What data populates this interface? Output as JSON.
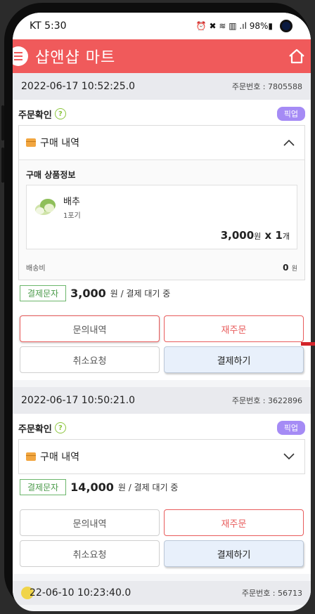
{
  "status_bar": {
    "carrier_time": "KT 5:30",
    "icons_text": "⏰ ✖ ≋ ▥ .ıl 98%▮"
  },
  "app": {
    "title": "샵앤샵 마트"
  },
  "orders": [
    {
      "datetime": "2022-06-17 10:52:25.0",
      "order_no": "주문번호 : 7805588",
      "confirm_label": "주문확인",
      "pickup_label": "픽업",
      "purchase_label": "구매 내역",
      "product_section": "구매 상품정보",
      "product_name": "배추",
      "product_unit": "1포기",
      "price_value": "3,000",
      "price_unit": "원",
      "qty_text": "x 1",
      "qty_unit": "개",
      "shipping_label": "배송비",
      "shipping_value": "0",
      "shipping_unit": "원",
      "pay_tag": "결제문자",
      "pay_amount": "3,000",
      "pay_status": "원 / 결제 대기 중",
      "btn_inquiry": "문의내역",
      "btn_reorder": "재주문",
      "btn_cancel": "취소요청",
      "btn_pay": "결제하기"
    },
    {
      "datetime": "2022-06-17 10:50:21.0",
      "order_no": "주문번호 : 3622896",
      "confirm_label": "주문확인",
      "pickup_label": "픽업",
      "purchase_label": "구매 내역",
      "pay_tag": "결제문자",
      "pay_amount": "14,000",
      "pay_status": "원 / 결제 대기 중",
      "btn_inquiry": "문의내역",
      "btn_reorder": "재주문",
      "btn_cancel": "취소요청",
      "btn_pay": "결제하기"
    },
    {
      "datetime": "22-06-10 10:23:40.0",
      "order_no": "주문번호 : 56713"
    }
  ],
  "colors": {
    "brand_red": "#f05a5b",
    "pickup_purple": "#a58bf5",
    "pay_green": "#6cb66b"
  }
}
